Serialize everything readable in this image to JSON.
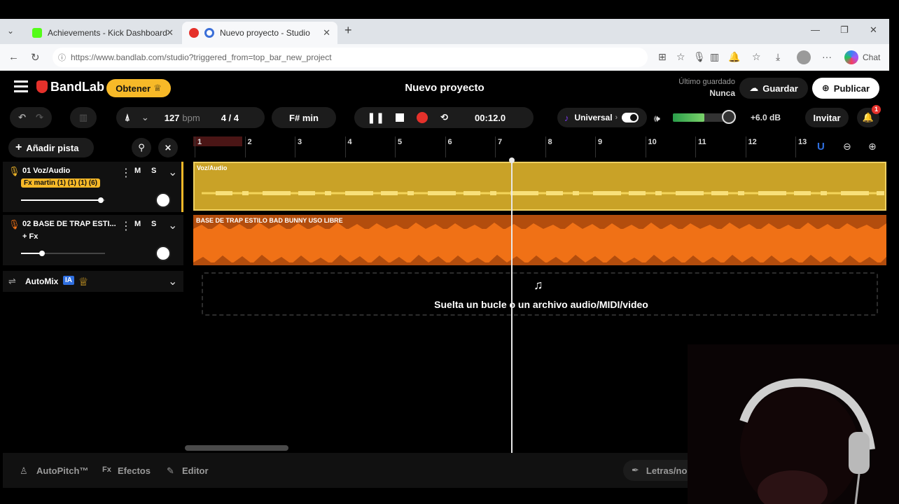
{
  "browser": {
    "tabs": [
      {
        "title": "Achievements - Kick Dashboard"
      },
      {
        "title": "Nuevo proyecto - Studio"
      }
    ],
    "url": "https://www.bandlab.com/studio?triggered_from=top_bar_new_project",
    "chat_label": "Chat"
  },
  "app": {
    "brand": "BandLab",
    "get_button": "Obtener",
    "project_title": "Nuevo proyecto",
    "last_saved_label": "Último guardado",
    "last_saved_value": "Nunca",
    "save_button": "Guardar",
    "publish_button": "Publicar"
  },
  "transport": {
    "bpm_value": "127",
    "bpm_unit": "bpm",
    "time_signature": "4 / 4",
    "key": "F# min",
    "time": "00:12.0",
    "universal_label": "Universal",
    "volume_db": "+6.0 dB",
    "invite_button": "Invitar",
    "notification_count": "1",
    "master_level": 0.55
  },
  "tracklist": {
    "add_track": "Añadir pista",
    "tracks": [
      {
        "name": "01 Voz/Audio",
        "fx": "Fx martin (1) (1) (1) (6)",
        "mute": "M",
        "solo": "S",
        "volume": 0.95
      },
      {
        "name": "02 BASE DE TRAP ESTI...",
        "fx": "+ Fx",
        "mute": "M",
        "solo": "S",
        "volume": 0.25
      }
    ],
    "automix": "AutoMix",
    "ia_badge": "IA"
  },
  "ruler": {
    "bars": [
      "1",
      "2",
      "3",
      "4",
      "5",
      "6",
      "7",
      "8",
      "9",
      "10",
      "11",
      "12",
      "13"
    ]
  },
  "clips": [
    {
      "label": "Voz/Audio",
      "color": "#c9a227"
    },
    {
      "label": "BASE DE TRAP ESTILO BAD BUNNY USO LIBRE",
      "color": "#f07116"
    }
  ],
  "dropzone": {
    "text": "Suelta un bucle o un archivo audio/MIDI/video"
  },
  "bottom": {
    "autopitch": "AutoPitch™",
    "effects": "Efectos",
    "editor": "Editor",
    "lyrics": "Letras/no"
  },
  "colors": {
    "accent": "#f7b928",
    "record": "#e5312b",
    "track1": "#c9a227",
    "track2": "#f07116"
  }
}
